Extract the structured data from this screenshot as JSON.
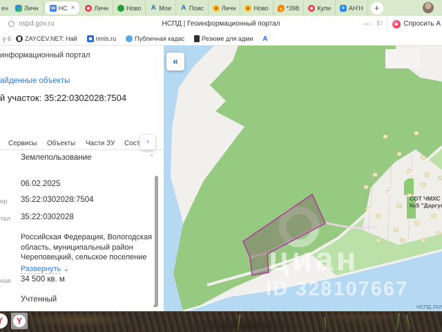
{
  "browser": {
    "tab_fragment": "ен",
    "tabs": [
      {
        "label": "Личн",
        "icon": "shield-blue-green"
      },
      {
        "label": "НС",
        "icon": "doc-blue",
        "active": true,
        "close": "×"
      },
      {
        "label": "Личн",
        "icon": "circle-red"
      },
      {
        "label": "Ново",
        "icon": "circle-green"
      },
      {
        "label": "Мои",
        "icon": "letter-a-blue"
      },
      {
        "label": "Поис",
        "icon": "letter-a-blue"
      },
      {
        "label": "Личн",
        "icon": "circle-yellow"
      },
      {
        "label": "Ново",
        "icon": "circle-yellow"
      },
      {
        "label": "*398",
        "icon": "flame-orange"
      },
      {
        "label": "Купи",
        "icon": "circle-red"
      },
      {
        "label": "АН'Н",
        "icon": "vk-blue"
      }
    ],
    "new_tab_button": "+",
    "vk_icon_text": "в",
    "ya_icon_text": "А",
    "address_bar": {
      "url": "nspd.gov.ru",
      "page_title": "НСПД | Геоинформационный портал",
      "more_icon": "⋯",
      "bookmark_icon": "⚐",
      "ask_alice": "Спросить А"
    },
    "bookmark_fragment": "у 6",
    "bookmarks": [
      "ZAYCEV.NET: Най",
      "nmls.ru",
      "Публичная кадас",
      "Резюме для адми"
    ],
    "bookmark_ya_icon_text": "А"
  },
  "panel": {
    "portal_title_fragment": "информационный портал",
    "found_objects_link": "айденные объекты",
    "object_title_fragment": "й участок: 35:22:0302028:7504",
    "tabs": [
      "Сервисы",
      "Объекты",
      "Части ЗУ",
      "Состав"
    ],
    "icons": {
      "tabs_more": "›",
      "section_collapse": "⌃",
      "expand_chevron": "⌄",
      "scroll_down": "▾"
    },
    "section_title": "Землепользование",
    "date_value": "06.02.2025",
    "cadastral_number_label_fragment": "ер",
    "cadastral_number": "35:22:0302028:7504",
    "quarter_label_fragment": "тал",
    "quarter": "35:22:0302028",
    "address": "Российская Федерация, Вологодская область, муниципальный район Череповецкий, сельское поселение",
    "expand_link": "Развернуть",
    "area_label_fragment": "ная",
    "area": "34 500 кв. м",
    "status": "Учтенный"
  },
  "map": {
    "collapse_button": "«",
    "settlement_label_line1": "СОТ ЧМХС",
    "settlement_label_line2": "№5 \"Даргун",
    "watermark_title": "циан",
    "watermark_id": "ID 328107667",
    "attribution": "НСПД 2025",
    "colors": {
      "water": "#b5d9f3",
      "forest": "#96ca81",
      "meadow": "#bbe0a8",
      "land": "#f2f0ec",
      "parcel_stroke": "#ae3f9e",
      "accent_blue": "#2b7ae0"
    }
  },
  "taskbar": {
    "yandex_logo": "Y"
  }
}
